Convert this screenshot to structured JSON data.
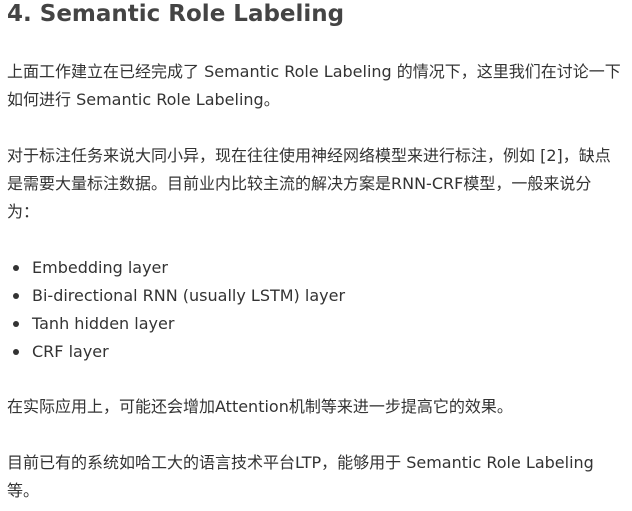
{
  "article": {
    "heading": "4. Semantic Role Labeling",
    "paragraphs": [
      "上面工作建立在已经完成了 Semantic Role Labeling 的情况下，这里我们在讨论一下如何进行 Semantic Role Labeling。",
      "对于标注任务来说大同小异，现在往往使用神经网络模型来进行标注，例如 [2]，缺点是需要大量标注数据。目前业内比较主流的解决方案是RNN-CRF模型，一般来说分为：",
      "在实际应用上，可能还会增加Attention机制等来进一步提高它的效果。",
      "目前已有的系统如哈工大的语言技术平台LTP，能够用于 Semantic Role Labeling 等。"
    ],
    "bullets": [
      "Embedding layer",
      "Bi-directional RNN (usually LSTM) layer",
      "Tanh hidden layer",
      "CRF layer"
    ]
  }
}
